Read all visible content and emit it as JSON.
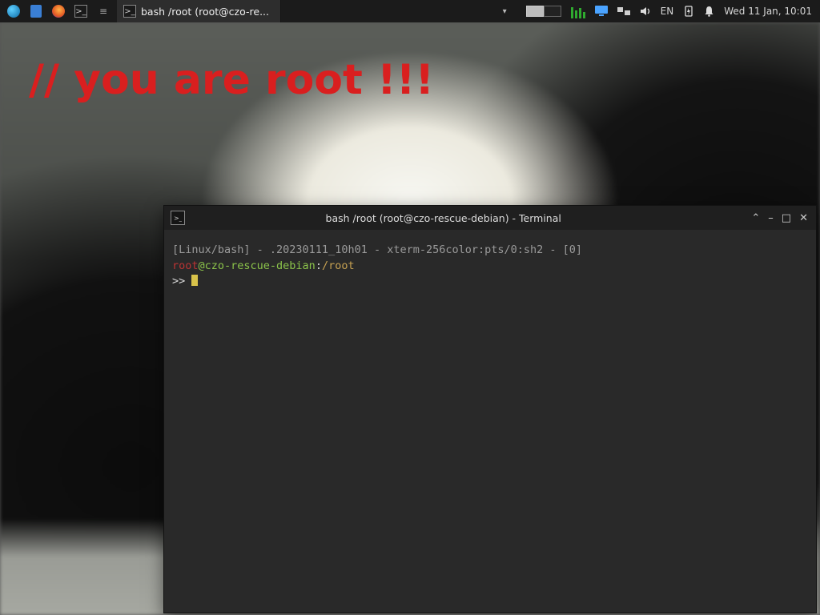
{
  "panel": {
    "task_label": "bash /root (root@czo-re...",
    "lang": "EN",
    "clock": "Wed 11 Jan, 10:01"
  },
  "desktop": {
    "banner": "// you are root !!!"
  },
  "terminal": {
    "title": "bash /root (root@czo-rescue-debian) - Terminal",
    "line1": "[Linux/bash] - .20230111_10h01 - xterm-256color:pts/0:sh2 - [0]",
    "user": "root",
    "at_host": "@czo-rescue-debian",
    "sep": ":",
    "cwd": "/root",
    "ps2": ">> "
  }
}
